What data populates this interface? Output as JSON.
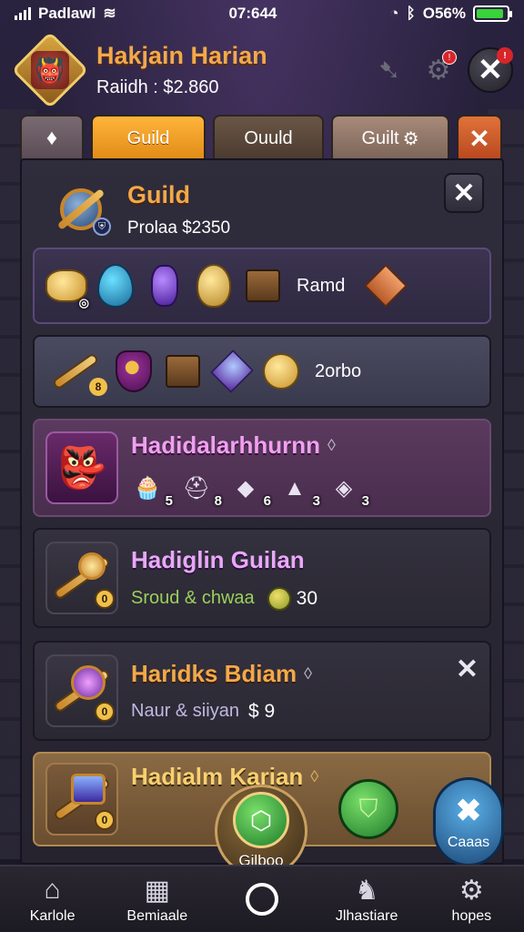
{
  "status_bar": {
    "carrier": "Padlawl",
    "time": "07:644",
    "battery": "O56%",
    "battery_level": 0.9
  },
  "header": {
    "player_name": "Hakjain Harian",
    "player_sub": "Raiidh : $2.860",
    "avatar_icon": "demon-face",
    "icons": [
      "horn-icon",
      "gear-icon"
    ],
    "close_label": "✕"
  },
  "tabs": [
    {
      "label": "",
      "icon": "crystal-icon"
    },
    {
      "label": "Guild"
    },
    {
      "label": "Ouuld"
    },
    {
      "label": "Guilt"
    },
    {
      "label": "✕"
    }
  ],
  "guild": {
    "title": "Guild",
    "subtitle": "Prolaa $2350",
    "close_label": "✕"
  },
  "rows": {
    "row1": {
      "label": "Ramd"
    },
    "row2": {
      "label": "2orbo"
    },
    "row3": {
      "title": "Hadidalarhhurnn",
      "counts": [
        "5",
        "8",
        "6",
        "3",
        "3"
      ]
    },
    "row4": {
      "title": "Hadiglin Guilan",
      "desc": "Sroud  & chwaa",
      "value": "30"
    },
    "row5": {
      "title": "Haridks Bdiam",
      "desc": "Naur & siiyan",
      "value": "$ 9"
    },
    "row6": {
      "title": "Hadialm Karian"
    }
  },
  "fabs": {
    "center_label": "Gilboo",
    "blue_label": "Caaas"
  },
  "bottom_nav": [
    {
      "label": "Karlole",
      "icon": "home-icon"
    },
    {
      "label": "Bemiaale",
      "icon": "inventory-icon"
    },
    {
      "label": "",
      "icon": "circle-home-icon"
    },
    {
      "label": "Jlhastiare",
      "icon": "mount-icon"
    },
    {
      "label": "hopes",
      "icon": "settings-icon"
    }
  ]
}
